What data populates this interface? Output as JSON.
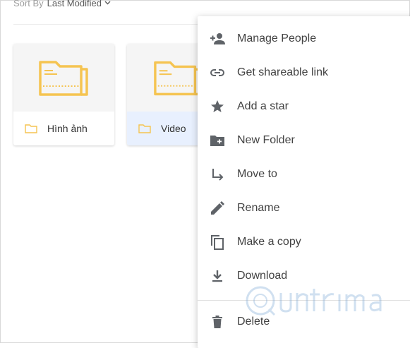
{
  "sort": {
    "label": "Sort By",
    "value": "Last Modified"
  },
  "folders": [
    {
      "name": "Hình ảnh"
    },
    {
      "name": "Video"
    }
  ],
  "menu": {
    "items": [
      {
        "label": "Manage People",
        "icon": "person-add-icon"
      },
      {
        "label": "Get shareable link",
        "icon": "link-icon"
      },
      {
        "label": "Add a star",
        "icon": "star-icon"
      },
      {
        "label": "New Folder",
        "icon": "new-folder-icon"
      },
      {
        "label": "Move to",
        "icon": "move-arrow-icon"
      },
      {
        "label": "Rename",
        "icon": "pencil-icon"
      },
      {
        "label": "Make a copy",
        "icon": "copy-icon"
      },
      {
        "label": "Download",
        "icon": "download-icon"
      },
      {
        "label": "Delete",
        "icon": "trash-icon"
      }
    ]
  },
  "colors": {
    "folder": "#f5c451",
    "icon": "#5f6368",
    "selected": "#e8f0fe"
  }
}
